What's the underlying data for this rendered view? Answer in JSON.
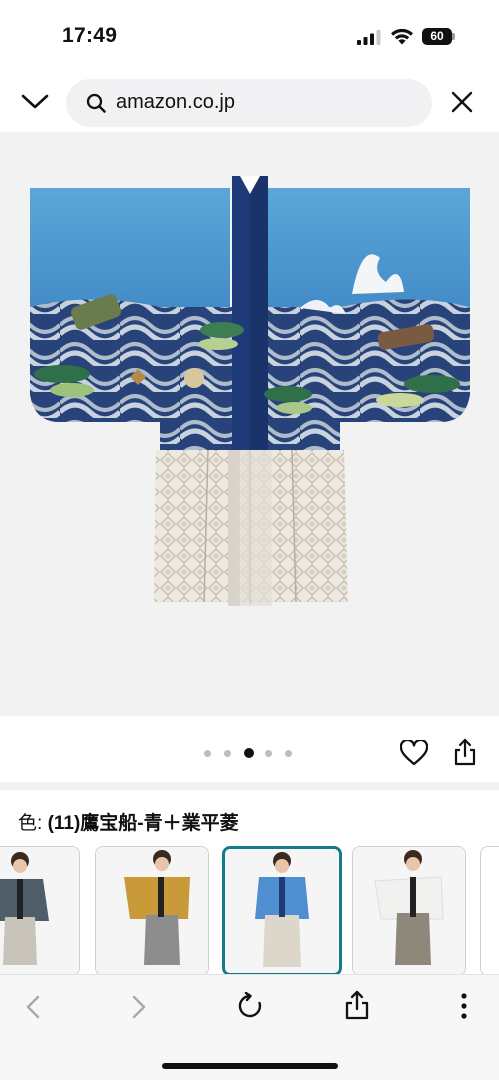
{
  "status_bar": {
    "time": "17:49",
    "battery_level": "60",
    "icons": [
      "signal-icon",
      "wifi-icon",
      "battery-icon"
    ]
  },
  "browser": {
    "url": "amazon.co.jp",
    "icons": [
      "chevron-down-icon",
      "search-icon",
      "close-icon"
    ]
  },
  "product": {
    "image_alt_description_icon": "kimono-hakama-icon",
    "carousel": {
      "total": 5,
      "active_index": 2
    },
    "actions": [
      "heart-icon",
      "share-icon"
    ]
  },
  "color": {
    "label": "色:",
    "value": "(11)鷹宝船-青＋業平菱"
  },
  "swatches": [
    {
      "name": "gray-kimono",
      "jacket": "#4f5d68",
      "skirt": "#c9c4bb",
      "selected": false
    },
    {
      "name": "gold-kimono",
      "jacket": "#c99a3a",
      "skirt": "#8d8d8d",
      "selected": false
    },
    {
      "name": "blue-kimono",
      "jacket": "#4f8fcf",
      "skirt": "#ddd7cb",
      "selected": true
    },
    {
      "name": "white-kimono",
      "jacket": "#f1f1ef",
      "skirt": "#8e887a",
      "selected": false
    }
  ],
  "colors": {
    "accent_selected": "#147b8a",
    "kimono_blue": "#4a9bd1",
    "kimono_navy": "#1f3a78"
  },
  "bottom_bar": {
    "icons": [
      "back-icon",
      "forward-icon",
      "reload-icon",
      "share-icon",
      "more-icon"
    ]
  }
}
